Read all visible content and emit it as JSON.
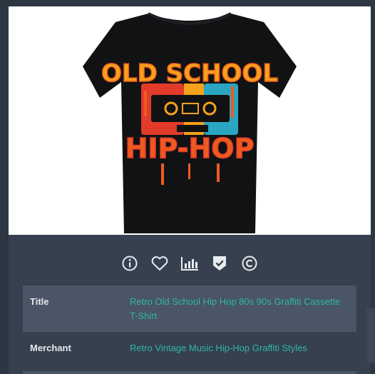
{
  "product": {
    "shirt_text_top": "OLD SCHOOL",
    "shirt_text_bottom": "HIP-HOP",
    "shirt_color": "#111214",
    "accent_colors": [
      "#f7a21b",
      "#ef5a1f",
      "#e23b2a",
      "#2aa6c2"
    ]
  },
  "icon_bar": {
    "icons": [
      {
        "name": "info-icon"
      },
      {
        "name": "heart-icon"
      },
      {
        "name": "bar-chart-icon"
      },
      {
        "name": "shield-check-icon"
      },
      {
        "name": "copyright-icon"
      }
    ]
  },
  "details": {
    "rows": [
      {
        "label": "Title",
        "value": "Retro Old School Hip Hop 80s 90s Graffiti Cassette T-Shirt"
      },
      {
        "label": "Merchant",
        "value": "Retro Vintage Music Hip-Hop Graffiti Styles"
      }
    ]
  },
  "colors": {
    "background": "#2d3643",
    "card": "#36404e",
    "row_alt": "#4a5566",
    "link": "#2fb7a5",
    "label": "#e6e8ec",
    "icon": "#e8ebef"
  }
}
